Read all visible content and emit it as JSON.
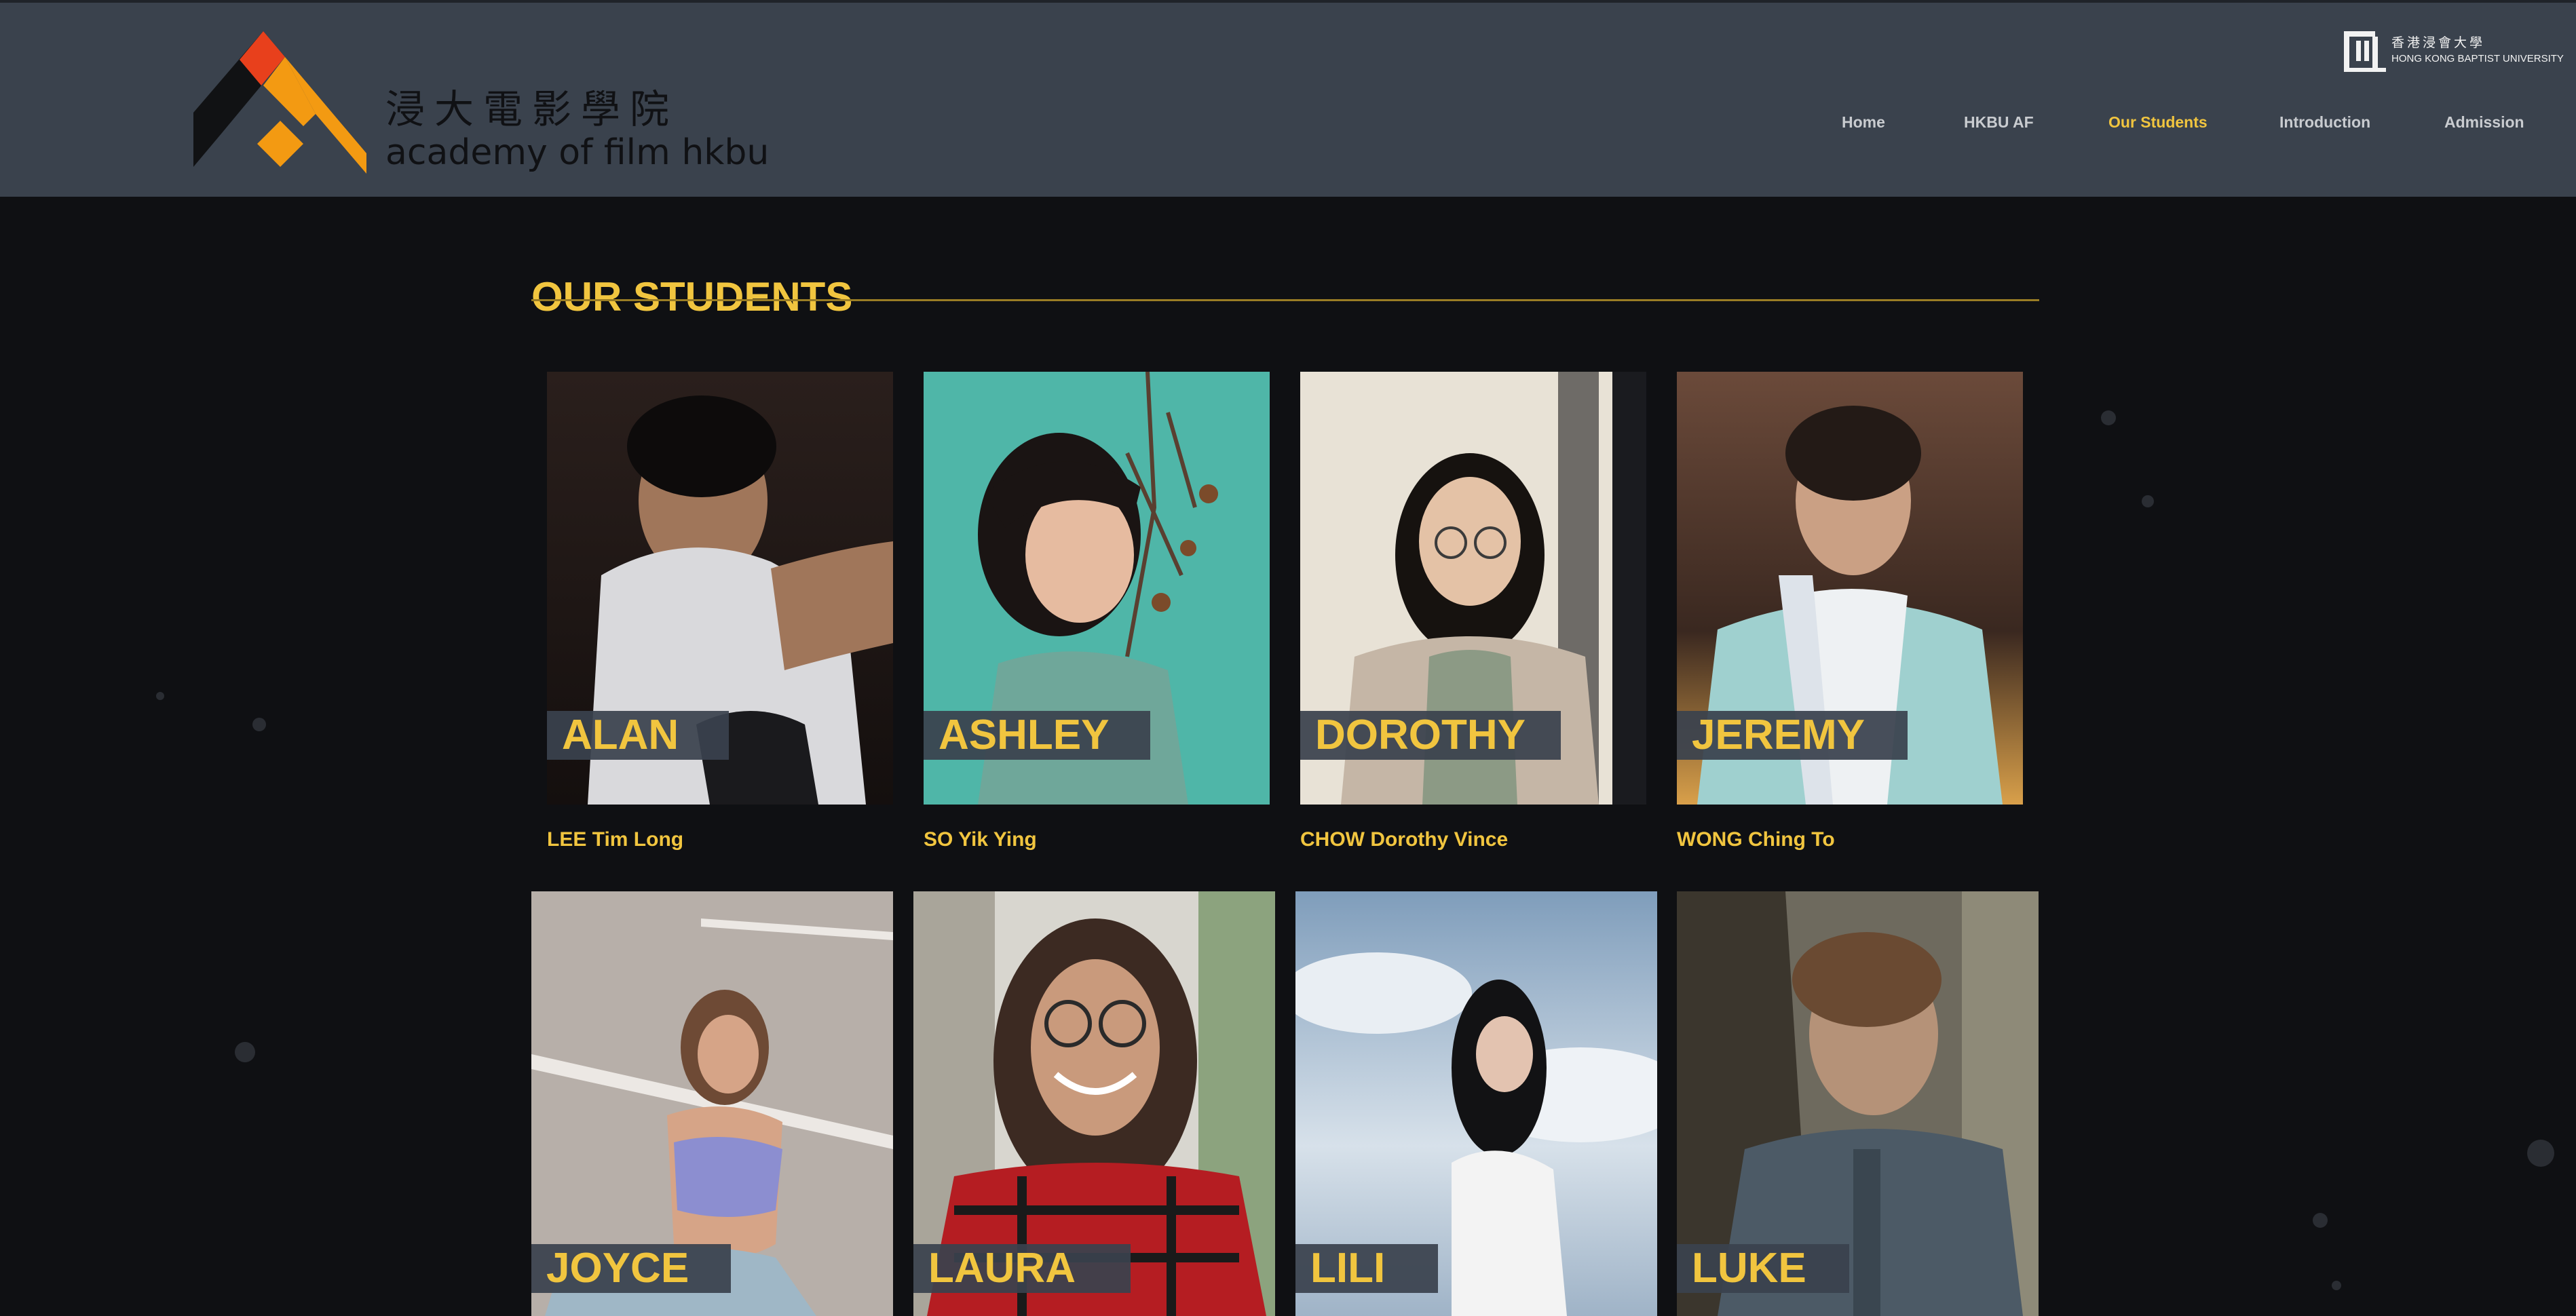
{
  "brand": {
    "chinese_name": "浸大電影學院",
    "english_name": "academy of film hkbu"
  },
  "university": {
    "chinese_name": "香港浸會大學",
    "english_name": "HONG KONG BAPTIST UNIVERSITY"
  },
  "nav": {
    "items": [
      {
        "label": "Home",
        "active": false
      },
      {
        "label": "HKBU AF",
        "active": false
      },
      {
        "label": "Our Students",
        "active": true
      },
      {
        "label": "Introduction",
        "active": false
      },
      {
        "label": "Admission",
        "active": false
      }
    ]
  },
  "page": {
    "title": "OUR STUDENTS"
  },
  "students": [
    {
      "short_name": "ALAN",
      "full_name": "LEE Tim Long"
    },
    {
      "short_name": "ASHLEY",
      "full_name": "SO Yik Ying"
    },
    {
      "short_name": "DOROTHY",
      "full_name": "CHOW Dorothy Vince"
    },
    {
      "short_name": "JEREMY",
      "full_name": "WONG Ching To"
    },
    {
      "short_name": "JOYCE",
      "full_name": ""
    },
    {
      "short_name": "LAURA",
      "full_name": ""
    },
    {
      "short_name": "LILI",
      "full_name": ""
    },
    {
      "short_name": "LUKE",
      "full_name": ""
    }
  ],
  "colors": {
    "accent": "#f1c53f",
    "header_bg": "#3a424d",
    "page_bg": "#0f1013",
    "logo_orange": "#f39a12",
    "logo_red": "#e8401c",
    "logo_black": "#111214"
  }
}
